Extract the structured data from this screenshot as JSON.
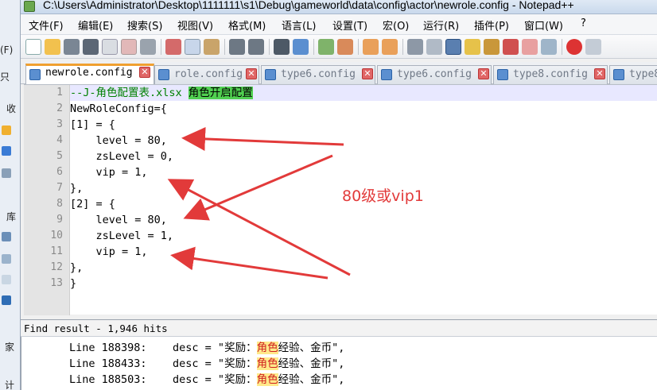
{
  "window": {
    "title": "C:\\Users\\Administrator\\Desktop\\1111111\\s1\\Debug\\gameworld\\data\\config\\actor\\newrole.config - Notepad++"
  },
  "background_window": {
    "items": [
      "(F)",
      "只",
      "收",
      "库",
      "家",
      "计"
    ]
  },
  "menu": {
    "items": [
      "文件(F)",
      "编辑(E)",
      "搜索(S)",
      "视图(V)",
      "格式(M)",
      "语言(L)",
      "设置(T)",
      "宏(O)",
      "运行(R)",
      "插件(P)",
      "窗口(W)",
      "?"
    ]
  },
  "toolbar": {
    "icons": [
      "new-file-icon",
      "open-file-icon",
      "save-icon",
      "save-all-icon",
      "close-icon",
      "close-all-icon",
      "print-icon",
      "cut-icon",
      "copy-icon",
      "paste-icon",
      "undo-icon",
      "redo-icon",
      "find-icon",
      "replace-icon",
      "zoom-in-icon",
      "zoom-out-icon",
      "sync-vertical-icon",
      "sync-horizontal-icon",
      "word-wrap-icon",
      "show-all-chars-icon",
      "indent-guide-icon",
      "doc-map-icon",
      "function-list-icon",
      "folder-workspace-icon",
      "monitor-icon",
      "record-macro-icon"
    ]
  },
  "tabs": [
    {
      "label": "newrole.config",
      "active": true
    },
    {
      "label": "role.config",
      "active": false
    },
    {
      "label": "type6.config",
      "active": false
    },
    {
      "label": "type6.config",
      "active": false
    },
    {
      "label": "type8.config",
      "active": false
    },
    {
      "label": "type8",
      "active": false
    }
  ],
  "tab_close_glyph": "✕",
  "editor": {
    "line_numbers": [
      "1",
      "2",
      "3",
      "4",
      "5",
      "6",
      "7",
      "8",
      "9",
      "10",
      "11",
      "12",
      "13"
    ],
    "lines": [
      {
        "text": "--J-角色配置表.xlsx ",
        "highlight": "角色开启配置"
      },
      {
        "text": "NewRoleConfig={"
      },
      {
        "text": "[1] = {"
      },
      {
        "text": "    level = 80,"
      },
      {
        "text": "    zsLevel = 0,"
      },
      {
        "text": "    vip = 1,"
      },
      {
        "text": "},"
      },
      {
        "text": "[2] = {"
      },
      {
        "text": "    level = 80,"
      },
      {
        "text": "    zsLevel = 1,"
      },
      {
        "text": "    vip = 1,"
      },
      {
        "text": "},"
      },
      {
        "text": "}"
      }
    ]
  },
  "annotation": {
    "text": "80级或vip1",
    "color": "#e23a3a"
  },
  "find_result": {
    "title": "Find result - 1,946 hits",
    "rows": [
      {
        "prefix": "Line 188398:    desc = \"奖励：",
        "hit": "角色",
        "suffix": "经验、金币\","
      },
      {
        "prefix": "Line 188433:    desc = \"奖励：",
        "hit": "角色",
        "suffix": "经验、金币\","
      },
      {
        "prefix": "Line 188503:    desc = \"奖励：",
        "hit": "角色",
        "suffix": "经验、金币\","
      }
    ]
  },
  "colors": {
    "comment": "#008000",
    "find_highlight_bg": "#ffe98a",
    "find_highlight_fg": "#d02020",
    "tag_highlight": "#50d050",
    "active_tab_accent": "#f0a030"
  }
}
